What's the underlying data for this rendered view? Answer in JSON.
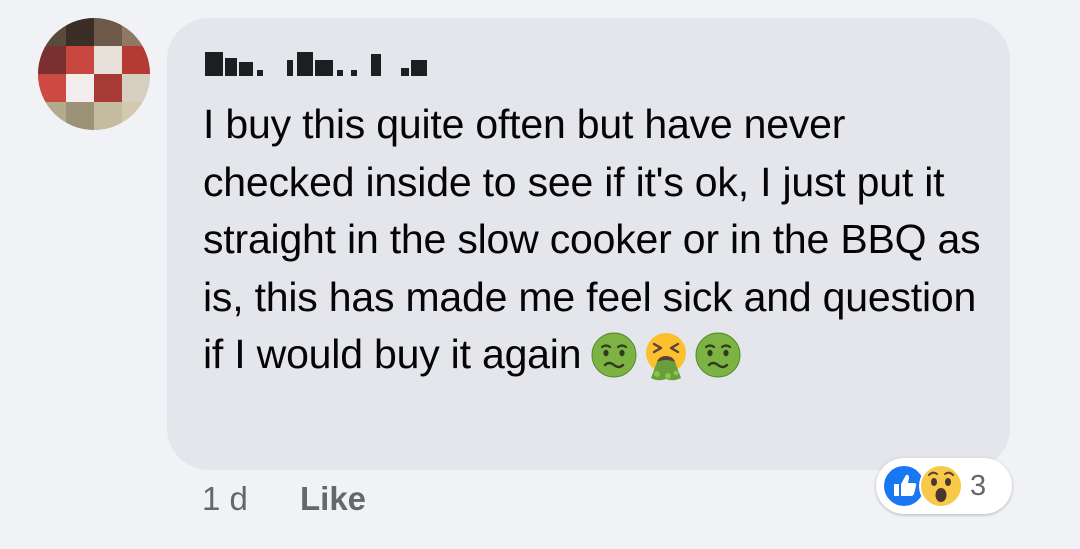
{
  "comment": {
    "author_name": "",
    "text": "I buy this quite often but have never checked inside to see if it's ok, I just put it straight in the slow cooker or in the BBQ as is, this has made me feel sick and question if I would buy it again",
    "emojis": [
      "nauseated-face",
      "face-vomiting",
      "nauseated-face"
    ],
    "timestamp": "1 d",
    "like_label": "Like",
    "reaction_types": [
      "like",
      "wow"
    ],
    "reaction_count": "3"
  },
  "colors": {
    "bubble": "#e4e6eb",
    "background": "#f0f2f5",
    "meta_text": "#65676b",
    "like_reaction": "#1877f2",
    "emoji_green": "#7cb342"
  },
  "icons": {
    "avatar": "pixelated-avatar",
    "author": "redacted-name-blocks"
  }
}
